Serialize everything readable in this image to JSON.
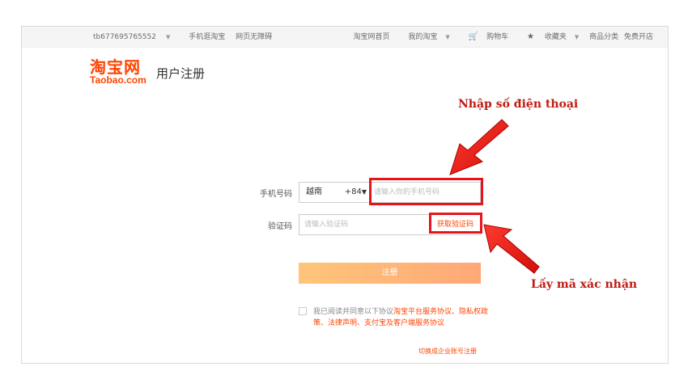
{
  "topbar": {
    "username": "tb677695765552",
    "mobile_taobao": "手机逛淘宝",
    "link2": "网页无障碍",
    "home": "淘宝网首页",
    "my_taobao": "我的淘宝",
    "cart": "购物车",
    "favorites": "收藏夹",
    "categories": "商品分类",
    "seller": "免费开店"
  },
  "logo": {
    "cn": "淘宝网",
    "en": "Taobao.com"
  },
  "page_title": "用户注册",
  "form": {
    "phone_label": "手机号码",
    "country_name": "越南",
    "country_code": "+84",
    "phone_placeholder": "请输入你的手机号码",
    "code_label": "验证码",
    "code_placeholder": "请输入验证码",
    "get_code": "获取验证码",
    "submit": "注册",
    "agree_text": "我已阅读并同意以下协议",
    "agree_links": "淘宝平台服务协议、隐私权政策、法律声明、支付宝及客户端服务协议",
    "enterprise_link": "切换成企业账号注册"
  },
  "annotations": {
    "phone": "Nhập số điện thoại",
    "code": "Lấy mã xác nhận"
  },
  "colors": {
    "accent": "#ff4400",
    "annotation": "#c21a12",
    "highlight": "#e8141c"
  }
}
